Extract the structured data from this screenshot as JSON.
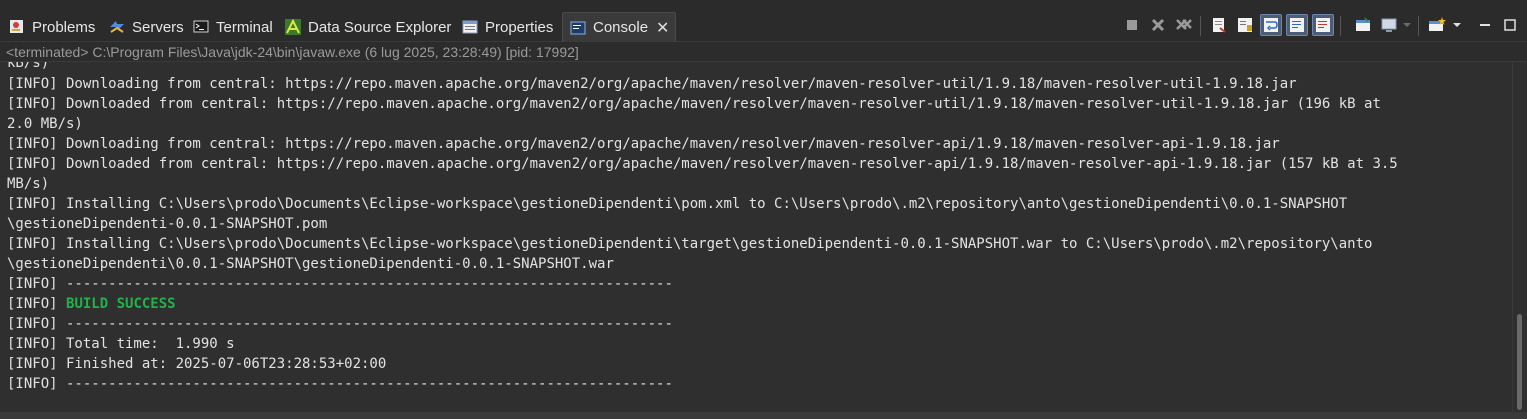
{
  "tabs": [
    {
      "label": "Problems",
      "icon": "problems-icon"
    },
    {
      "label": "Servers",
      "icon": "servers-icon"
    },
    {
      "label": "Terminal",
      "icon": "terminal-icon"
    },
    {
      "label": "Data Source Explorer",
      "icon": "data-source-icon"
    },
    {
      "label": "Properties",
      "icon": "properties-icon"
    },
    {
      "label": "Console",
      "icon": "console-icon",
      "active": true
    }
  ],
  "status_line": "<terminated> C:\\Program Files\\Java\\jdk-24\\bin\\javaw.exe (6 lug 2025, 23:28:49) [pid: 17992]",
  "console_lines": [
    {
      "text": "kB/s)"
    },
    {
      "text": "[INFO] Downloading from central: https://repo.maven.apache.org/maven2/org/apache/maven/resolver/maven-resolver-util/1.9.18/maven-resolver-util-1.9.18.jar"
    },
    {
      "text": "[INFO] Downloaded from central: https://repo.maven.apache.org/maven2/org/apache/maven/resolver/maven-resolver-util/1.9.18/maven-resolver-util-1.9.18.jar (196 kB at"
    },
    {
      "text": "2.0 MB/s)"
    },
    {
      "text": "[INFO] Downloading from central: https://repo.maven.apache.org/maven2/org/apache/maven/resolver/maven-resolver-api/1.9.18/maven-resolver-api-1.9.18.jar"
    },
    {
      "text": "[INFO] Downloaded from central: https://repo.maven.apache.org/maven2/org/apache/maven/resolver/maven-resolver-api/1.9.18/maven-resolver-api-1.9.18.jar (157 kB at 3.5"
    },
    {
      "text": "MB/s)"
    },
    {
      "text": "[INFO] Installing C:\\Users\\prodo\\Documents\\Eclipse-workspace\\gestioneDipendenti\\pom.xml to C:\\Users\\prodo\\.m2\\repository\\anto\\gestioneDipendenti\\0.0.1-SNAPSHOT"
    },
    {
      "text": "\\gestioneDipendenti-0.0.1-SNAPSHOT.pom"
    },
    {
      "text": "[INFO] Installing C:\\Users\\prodo\\Documents\\Eclipse-workspace\\gestioneDipendenti\\target\\gestioneDipendenti-0.0.1-SNAPSHOT.war to C:\\Users\\prodo\\.m2\\repository\\anto"
    },
    {
      "text": "\\gestioneDipendenti\\0.0.1-SNAPSHOT\\gestioneDipendenti-0.0.1-SNAPSHOT.war"
    },
    {
      "text": "[INFO] ------------------------------------------------------------------------"
    },
    {
      "prefix": "[INFO] ",
      "highlight": "BUILD SUCCESS"
    },
    {
      "text": "[INFO] ------------------------------------------------------------------------"
    },
    {
      "text": "[INFO] Total time:  1.990 s"
    },
    {
      "text": "[INFO] Finished at: 2025-07-06T23:28:53+02:00"
    },
    {
      "text": "[INFO] ------------------------------------------------------------------------"
    }
  ],
  "toolbar_icons": [
    "terminate-icon",
    "remove-launch-icon",
    "remove-all-terminated-icon",
    "clear-console-icon",
    "scroll-lock-icon",
    "word-wrap-icon",
    "show-on-stdout-icon",
    "show-on-stderr-icon",
    "pin-console-icon",
    "display-selected-console-icon",
    "display-console-dropdown-icon",
    "open-console-icon",
    "open-console-dropdown-icon",
    "minimize-icon",
    "maximize-icon"
  ],
  "colors": {
    "background": "#2f2f2f",
    "text": "#e2e2e2",
    "success": "#22b24c",
    "status_text": "#9a9a9a"
  }
}
